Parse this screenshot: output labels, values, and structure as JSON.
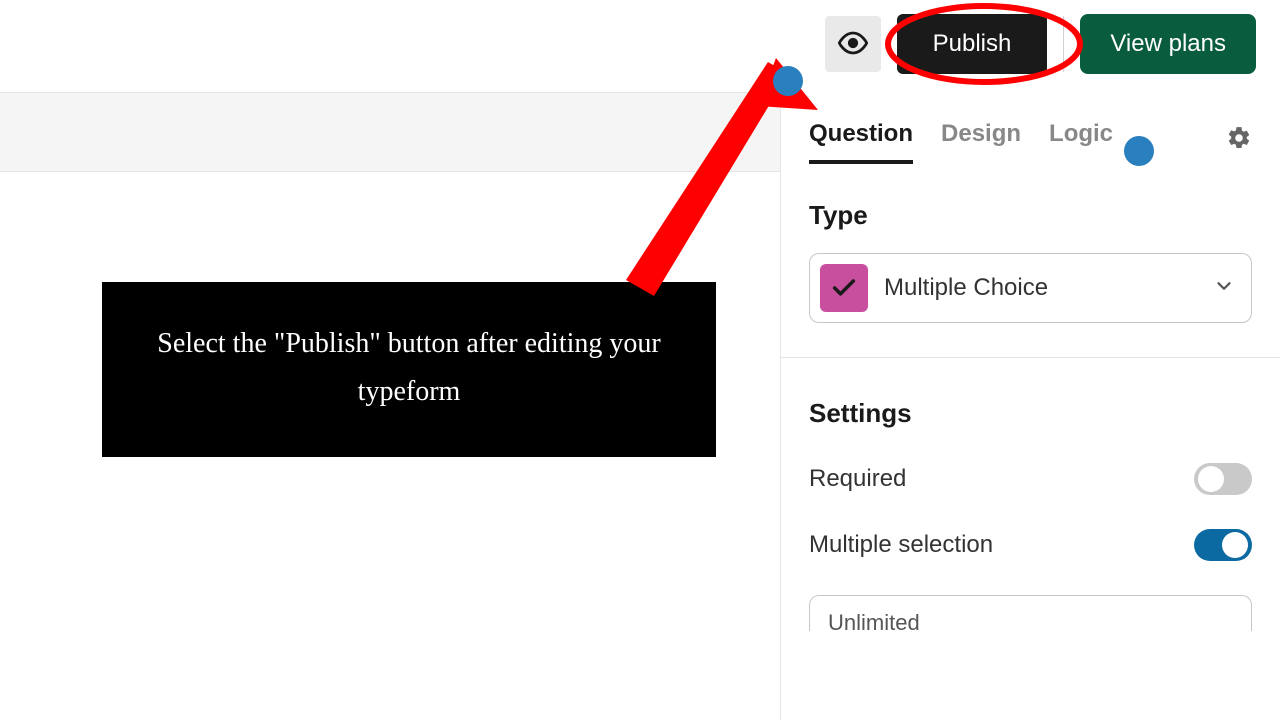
{
  "toolbar": {
    "publish_label": "Publish",
    "view_plans_label": "View plans"
  },
  "tabs": {
    "question": "Question",
    "design": "Design",
    "logic": "Logic"
  },
  "panel": {
    "type_heading": "Type",
    "type_value": "Multiple Choice",
    "settings_heading": "Settings",
    "required_label": "Required",
    "multiple_selection_label": "Multiple selection",
    "limit_value": "Unlimited"
  },
  "callout": {
    "text": "Select the \"Publish\" button after editing your typeform"
  },
  "colors": {
    "arrow": "#ff0000",
    "view_plans_bg": "#0a5c3e",
    "toggle_on": "#0a6aa1",
    "type_icon_bg": "#c84f9e",
    "blue_dot": "#2a7fbf"
  }
}
